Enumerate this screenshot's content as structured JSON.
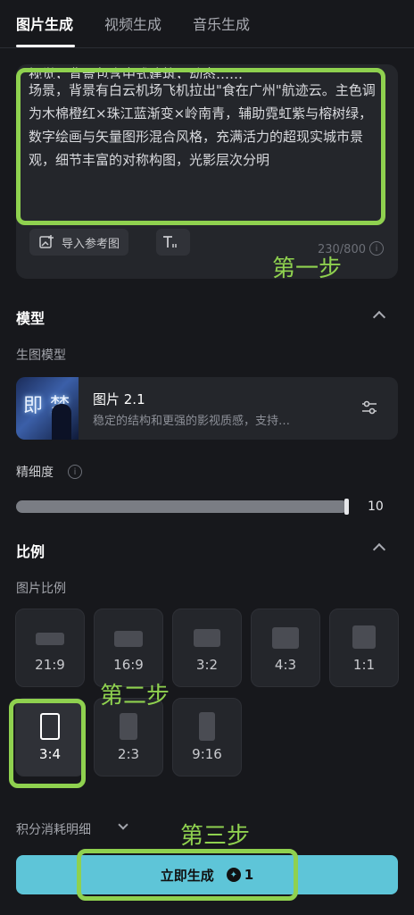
{
  "tabs": {
    "image": "图片生成",
    "video": "视频生成",
    "music": "音乐生成"
  },
  "prompt": {
    "partial_line": "视觉，背景包含中式建筑，动态……",
    "text": "场景，背景有白云机场飞机拉出\"食在广州\"航迹云。主色调为木棉橙红×珠江蓝渐变×岭南青，辅助霓虹紫与榕树绿，数字绘画与矢量图形混合风格，充满活力的超现实城市景观，细节丰富的对称构图，光影层次分明",
    "ref_button": "导入参考图",
    "text_tool_icon": "text-format-icon",
    "counter": "230/800"
  },
  "annotations": {
    "step1": "第一步",
    "step2": "第二步",
    "step3": "第三步"
  },
  "model": {
    "section_title": "模型",
    "sub_label": "生图模型",
    "thumb_text": "即梦",
    "name": "图片 2.1",
    "desc": "稳定的结构和更强的影视质感，支持…"
  },
  "precision": {
    "label": "精细度",
    "value": "10",
    "level": 1.0
  },
  "ratio": {
    "section_title": "比例",
    "sub_label": "图片比例",
    "options": [
      "21:9",
      "16:9",
      "3:2",
      "4:3",
      "1:1",
      "3:4",
      "2:3",
      "9:16"
    ],
    "selected": "3:4"
  },
  "credits": {
    "label": "积分消耗明细"
  },
  "generate": {
    "label": "立即生成",
    "cost": "1"
  },
  "colors": {
    "accent": "#5ec5d8",
    "highlight": "#8fd14f",
    "background": "#17181c"
  }
}
